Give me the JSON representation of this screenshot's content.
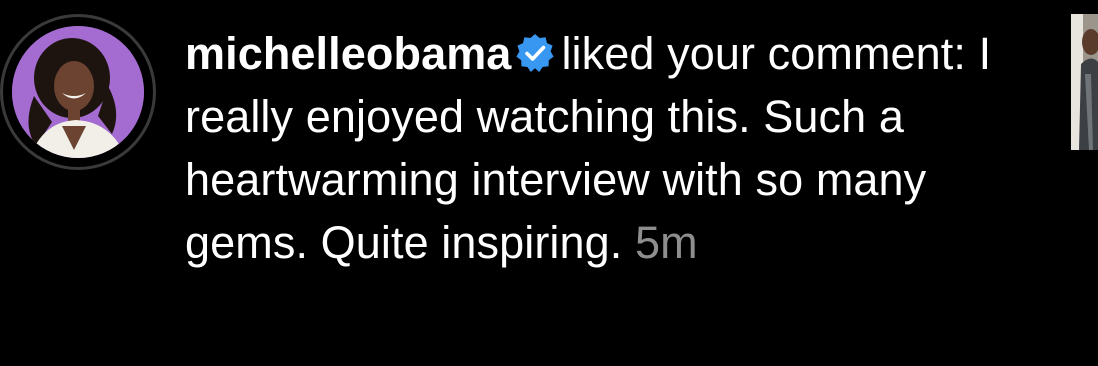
{
  "notification": {
    "username": "michelleobama",
    "verified": true,
    "verified_badge_color": "#3897f0",
    "action_text": "liked your comment:",
    "comment_text": "I really enjoyed watching this. Such a heartwarming interview with so many gems. Quite inspiring.",
    "timestamp": "5m",
    "avatar_icon": "profile-photo",
    "thumbnail_icon": "post-thumbnail"
  }
}
